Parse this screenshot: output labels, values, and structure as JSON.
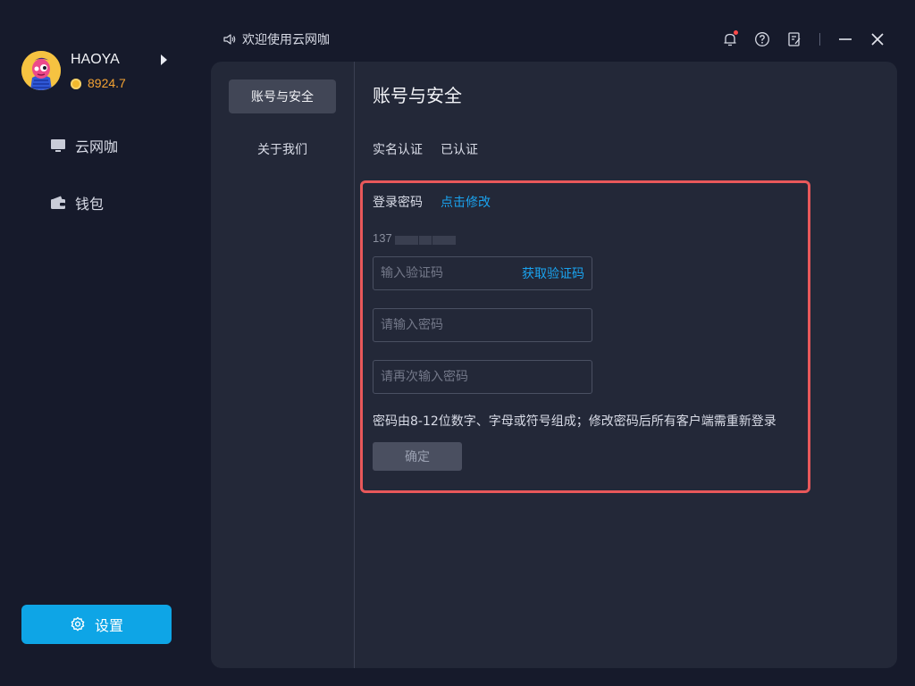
{
  "user": {
    "name": "HAOYA",
    "balance": "8924.7"
  },
  "nav": {
    "items": [
      {
        "label": "云网咖",
        "icon": "monitor-icon"
      },
      {
        "label": "钱包",
        "icon": "wallet-icon"
      }
    ]
  },
  "settings_button": {
    "label": "设置",
    "icon": "gear-icon"
  },
  "topbar": {
    "title": "欢迎使用云网咖",
    "icons": [
      "speaker-icon",
      "bell-icon",
      "help-icon",
      "feedback-icon",
      "minimize-icon",
      "close-icon"
    ]
  },
  "side_tabs": [
    {
      "label": "账号与安全",
      "active": true
    },
    {
      "label": "关于我们",
      "active": false
    }
  ],
  "content": {
    "title": "账号与安全",
    "realname": {
      "label": "实名认证",
      "value": "已认证"
    },
    "password": {
      "label": "登录密码",
      "link": "点击修改",
      "phone_prefix": "137",
      "code_placeholder": "输入验证码",
      "get_code": "获取验证码",
      "new_placeholder": "请输入密码",
      "repeat_placeholder": "请再次输入密码",
      "hint": "密码由8-12位数字、字母或符号组成；修改密码后所有客户端需重新登录",
      "confirm": "确定"
    }
  },
  "colors": {
    "accent": "#0ea5e6",
    "link": "#1aa3ef",
    "balance": "#f3a233",
    "highlight_border": "#e8585a"
  }
}
